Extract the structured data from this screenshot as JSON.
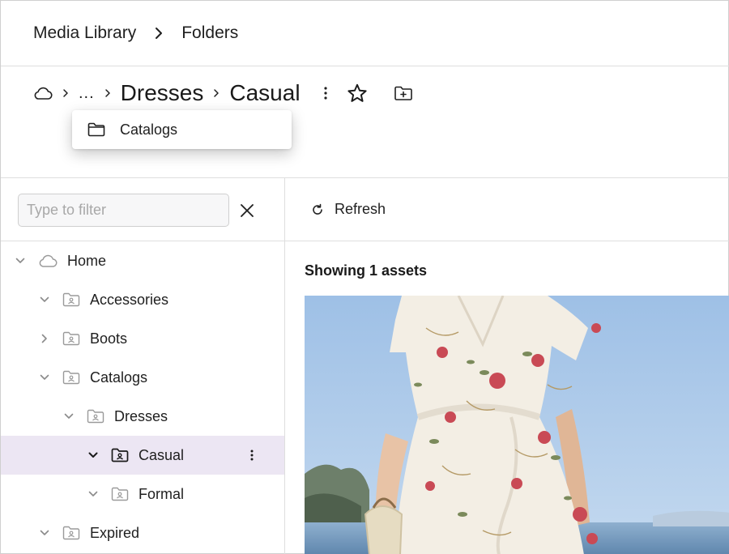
{
  "topbar": {
    "crumbs": [
      "Media Library",
      "Folders"
    ]
  },
  "path": {
    "ellipsis": "...",
    "segments": [
      "Dresses",
      "Casual"
    ],
    "icons": [
      "cloud-icon",
      "more-vertical-icon",
      "star-icon",
      "new-folder-icon"
    ]
  },
  "popup": {
    "items": [
      {
        "label": "Catalogs",
        "icon": "folder-icon"
      }
    ]
  },
  "sidebar": {
    "filter": {
      "placeholder": "Type to filter",
      "value": ""
    },
    "tree": [
      {
        "label": "Home",
        "level": 0,
        "state": "expanded",
        "icon": "cloud-icon"
      },
      {
        "label": "Accessories",
        "level": 1,
        "state": "expanded",
        "icon": "folder-icon"
      },
      {
        "label": "Boots",
        "level": 1,
        "state": "collapsed",
        "icon": "folder-icon"
      },
      {
        "label": "Catalogs",
        "level": 1,
        "state": "expanded",
        "icon": "folder-icon"
      },
      {
        "label": "Dresses",
        "level": 2,
        "state": "expanded",
        "icon": "folder-icon"
      },
      {
        "label": "Casual",
        "level": 3,
        "state": "expanded",
        "icon": "folder-icon",
        "selected": true
      },
      {
        "label": "Formal",
        "level": 3,
        "state": "expanded",
        "icon": "folder-icon"
      },
      {
        "label": "Expired",
        "level": 1,
        "state": "expanded",
        "icon": "folder-icon"
      }
    ]
  },
  "main": {
    "refresh_label": "Refresh",
    "count_text": "Showing 1 assets"
  },
  "colors": {
    "selected_row": "#ece6f3",
    "border": "#dedede",
    "sky": "#a9c6e6"
  }
}
